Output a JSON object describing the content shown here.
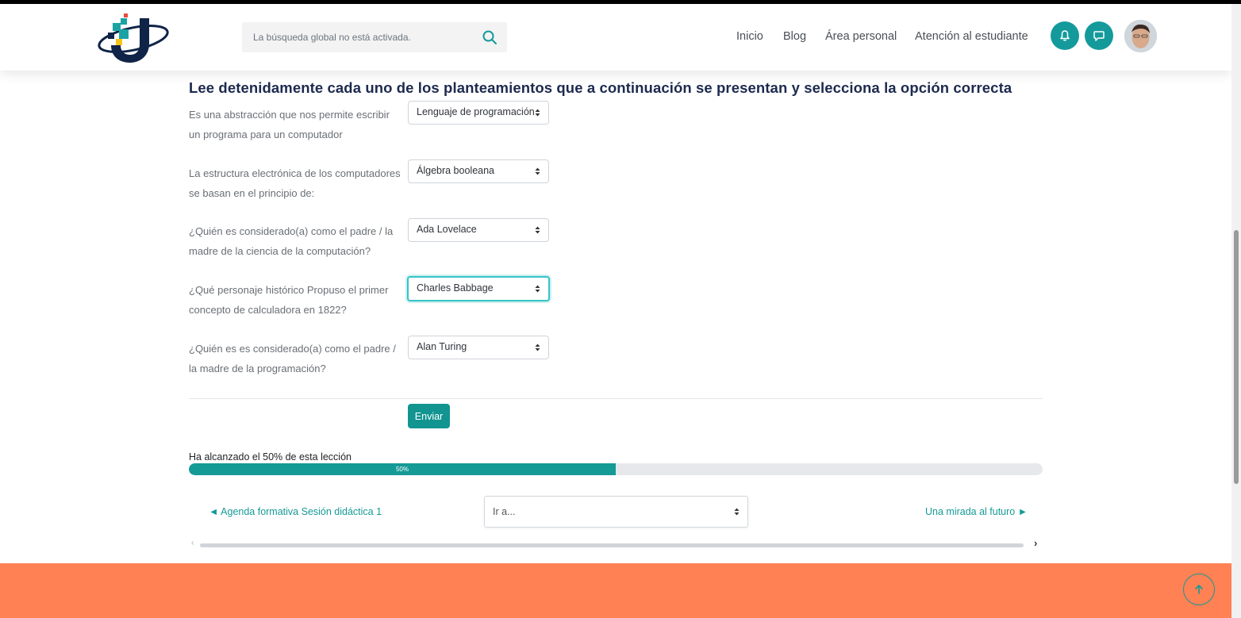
{
  "header": {
    "search_placeholder": "La búsqueda global no está activada.",
    "nav": [
      "Inicio",
      "Blog",
      "Área personal",
      "Atención al estudiante"
    ],
    "accent_color": "#159a9c"
  },
  "quiz": {
    "title": "Lee detenidamente cada uno de los planteamientos que a continuación se presentan y selecciona la opción correcta",
    "questions": [
      {
        "text": "Es una abstracción que nos permite escribir un programa para un computador",
        "answer": "Lenguaje de programación"
      },
      {
        "text": "La estructura electrónica de los computadores se basan en el principio de:",
        "answer": "Álgebra booleana"
      },
      {
        "text": "¿Quién es considerado(a)  como el padre / la madre de la ciencia de la computación?",
        "answer": "Ada Lovelace"
      },
      {
        "text": "¿Qué personaje histórico Propuso el primer concepto de calculadora en 1822?",
        "answer": "Charles Babbage"
      },
      {
        "text": "¿Quién es es considerado(a) como el padre / la madre de la programación?",
        "answer": "Alan Turing"
      }
    ],
    "submit_label": "Enviar"
  },
  "progress": {
    "label": "Ha alcanzado el 50% de esta lección",
    "value_text": "50%",
    "value": 50,
    "bar_color": "#159a96"
  },
  "pagination": {
    "prev_label": "◄ Agenda formativa Sesión didáctica 1",
    "jump_label": "Ir a...",
    "next_label": "Una mirada al futuro ►"
  },
  "footer": {
    "color": "#ff8154"
  }
}
